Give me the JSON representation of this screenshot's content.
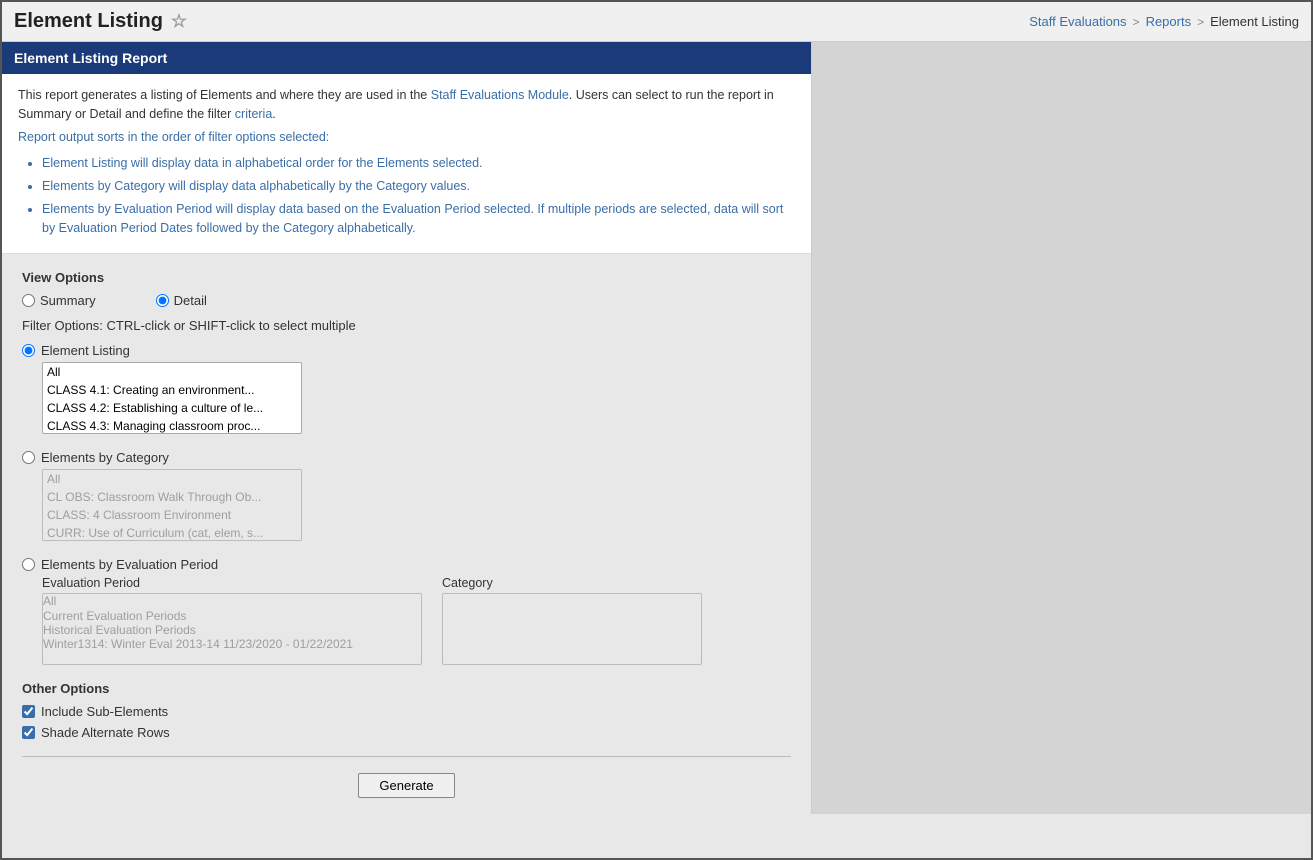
{
  "title": "Element Listing",
  "star": "☆",
  "breadcrumb": {
    "items": [
      {
        "label": "Staff Evaluations",
        "href": "#"
      },
      {
        "label": "Reports",
        "href": "#"
      },
      {
        "label": "Element Listing"
      }
    ],
    "separators": [
      ">",
      ">"
    ]
  },
  "report": {
    "header": "Element Listing Report",
    "description_line1": "This report generates a listing of Elements and where they are used in the Staff Evaluations Module. Users can select to run the report in Summary or Detail and define the filter criteria.",
    "description_line2": "Report output sorts in the order of filter options selected:",
    "bullets": [
      "Element Listing will display data in alphabetical order for the Elements selected.",
      "Elements by Category will display data alphabetically by the Category values.",
      "Elements by Evaluation Period will display data based on the Evaluation Period selected. If multiple periods are selected, data will sort by Evaluation Period Dates followed by the Category alphabetically."
    ]
  },
  "view_options": {
    "label": "View Options",
    "summary_label": "Summary",
    "detail_label": "Detail",
    "selected": "detail"
  },
  "filter_options": {
    "label": "Filter Options:",
    "hint": " CTRL-click or SHIFT-click to select multiple",
    "groups": [
      {
        "id": "element-listing",
        "label": "Element Listing",
        "selected": true,
        "options": [
          "All",
          "CLASS 4.1: Creating an environment...",
          "CLASS 4.2: Establishing a culture of le...",
          "CLASS 4.3: Managing classroom proc..."
        ]
      },
      {
        "id": "elements-by-category",
        "label": "Elements by Category",
        "selected": false,
        "options": [
          "All",
          "CL OBS: Classroom Walk Through Ob...",
          "CLASS: 4 Classroom Environment",
          "CURR: Use of Curriculum (cat, elem, s..."
        ]
      }
    ]
  },
  "eval_period": {
    "radio_label": "Elements by Evaluation Period",
    "selected": false,
    "eval_period_label": "Evaluation Period",
    "category_label": "Category",
    "eval_options": [
      "All",
      "Current Evaluation Periods",
      "Historical Evaluation Periods",
      "Winter1314: Winter Eval 2013-14 11/23/2020 - 01/22/2021"
    ],
    "category_options": []
  },
  "other_options": {
    "label": "Other Options",
    "include_sub_elements": {
      "label": "Include Sub-Elements",
      "checked": true
    },
    "shade_alternate_rows": {
      "label": "Shade Alternate Rows",
      "checked": true
    }
  },
  "generate_button": "Generate"
}
